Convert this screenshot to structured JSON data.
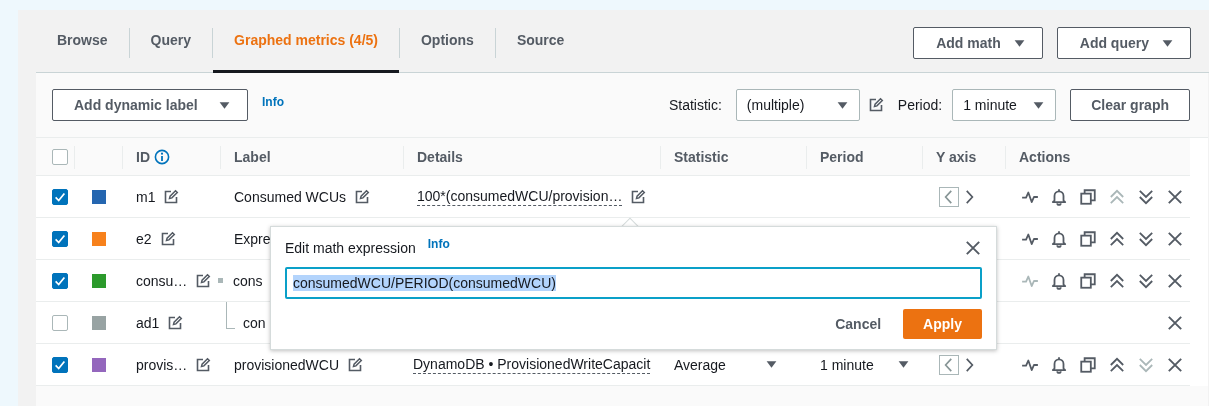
{
  "tabs": [
    {
      "label": "Browse",
      "selected": false
    },
    {
      "label": "Query",
      "selected": false
    },
    {
      "label": "Graphed metrics (4/5)",
      "selected": true
    },
    {
      "label": "Options",
      "selected": false
    },
    {
      "label": "Source",
      "selected": false
    }
  ],
  "header_buttons": [
    "Add math",
    "Add query"
  ],
  "toolbar": {
    "dynamic_label_button": "Add dynamic label",
    "info_link": "Info",
    "statistic_label": "Statistic:",
    "statistic_value": "(multiple)",
    "period_label": "Period:",
    "period_value": "1 minute",
    "clear_button": "Clear graph"
  },
  "table": {
    "select_all_checked": false,
    "columns": [
      "ID",
      "Label",
      "Details",
      "Statistic",
      "Period",
      "Y axis",
      "Actions"
    ],
    "rows": [
      {
        "id": "m1",
        "label": "Consumed WCUs",
        "label_edit_icon": true,
        "details": "100*(consumedWCU/provision…",
        "details_edit_icon": true,
        "checked": true,
        "color": "#2566b0",
        "y_axis_left": true,
        "actions": [
          {
            "kind": "graph",
            "disabled": false
          },
          {
            "kind": "alarm",
            "disabled": false
          },
          {
            "kind": "copy",
            "disabled": false
          },
          {
            "kind": "up",
            "disabled": true
          },
          {
            "kind": "down",
            "disabled": false
          },
          {
            "kind": "remove",
            "disabled": false
          }
        ]
      },
      {
        "id": "e2",
        "label": "Expre",
        "label_edit_icon": false,
        "checked": true,
        "color": "#f7811b",
        "actions": [
          {
            "kind": "graph",
            "disabled": false
          },
          {
            "kind": "alarm",
            "disabled": false
          },
          {
            "kind": "copy",
            "disabled": false
          },
          {
            "kind": "up",
            "disabled": false
          },
          {
            "kind": "down",
            "disabled": false
          },
          {
            "kind": "remove",
            "disabled": false
          }
        ]
      },
      {
        "id": "consu…",
        "label": "cons",
        "label_edit_icon": false,
        "checked": true,
        "color": "#2c9a2c",
        "actions": [
          {
            "kind": "graph",
            "disabled": true
          },
          {
            "kind": "alarm",
            "disabled": false
          },
          {
            "kind": "copy",
            "disabled": false
          },
          {
            "kind": "up",
            "disabled": false
          },
          {
            "kind": "down",
            "disabled": false
          },
          {
            "kind": "remove",
            "disabled": false
          }
        ],
        "children": [
          {
            "id": "ad1",
            "label": "con",
            "label_edit_icon": false,
            "checked": false,
            "color": "#98a3a3",
            "actions": [
              {
                "kind": "remove",
                "disabled": false
              }
            ]
          }
        ]
      },
      {
        "id": "provis…",
        "label": "provisionedWCU",
        "label_edit_icon": true,
        "details": "DynamoDB • ProvisionedWriteCapacit",
        "details_edit_icon": false,
        "statistic": "Average",
        "period": "1 minute",
        "checked": true,
        "color": "#9467bd",
        "y_axis_left": true,
        "actions": [
          {
            "kind": "graph",
            "disabled": false
          },
          {
            "kind": "alarm",
            "disabled": false
          },
          {
            "kind": "copy",
            "disabled": false
          },
          {
            "kind": "up",
            "disabled": false
          },
          {
            "kind": "down",
            "disabled": true
          },
          {
            "kind": "remove",
            "disabled": false
          }
        ]
      }
    ]
  },
  "popover": {
    "title": "Edit math expression",
    "info_link": "Info",
    "expression": "consumedWCU/PERIOD(consumedWCU)",
    "buttons": [
      "Cancel",
      "Apply"
    ]
  }
}
